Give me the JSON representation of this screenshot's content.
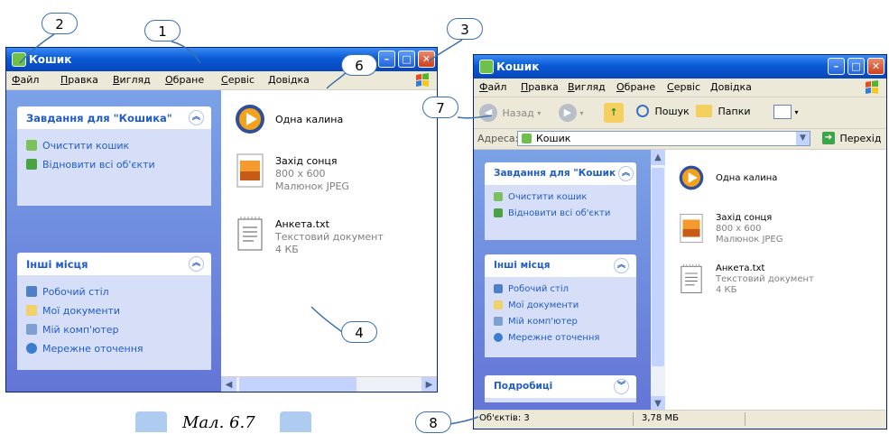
{
  "window": {
    "title": "Кошик",
    "menu": [
      "Файл",
      "Правка",
      "Вигляд",
      "Обране",
      "Сервіс",
      "Довідка"
    ]
  },
  "toolbar": {
    "back_label": "Назад",
    "search_label": "Пошук",
    "folders_label": "Папки"
  },
  "address": {
    "label": "Адреса:",
    "value": "Кошик",
    "go_label": "Перехід"
  },
  "tasks": {
    "recycle_title": "Завдання для \"Кошика\"",
    "recycle_title_cut": "Завдання для \"Кошик",
    "empty_bin": "Очистити кошик",
    "restore_all": "Відновити всі об'єкти",
    "other_title": "Інші місця",
    "desktop": "Робочий стіл",
    "my_docs": "Мої документи",
    "my_computer": "Мій комп'ютер",
    "network": "Мережне оточення",
    "details_title": "Подробиці"
  },
  "files": [
    {
      "name": "Одна калина",
      "icon": "media-player-icon"
    },
    {
      "name": "Захід сонця",
      "line1": "800 x 600",
      "line2": "Малюнок JPEG",
      "icon": "image-file-icon"
    },
    {
      "name": "Анкета.txt",
      "line1": "Текстовий документ",
      "line2": "4 КБ",
      "icon": "text-file-icon"
    }
  ],
  "status": {
    "objects": "Об'єктів: 3",
    "size": "3,78 МБ"
  },
  "callouts": [
    "1",
    "2",
    "3",
    "4",
    "6",
    "7",
    "8"
  ],
  "caption": "Мал. 6.7",
  "colors": {
    "titlebar": "#0a5ad6",
    "taskpane": "#6375d6",
    "link": "#215dc6"
  }
}
